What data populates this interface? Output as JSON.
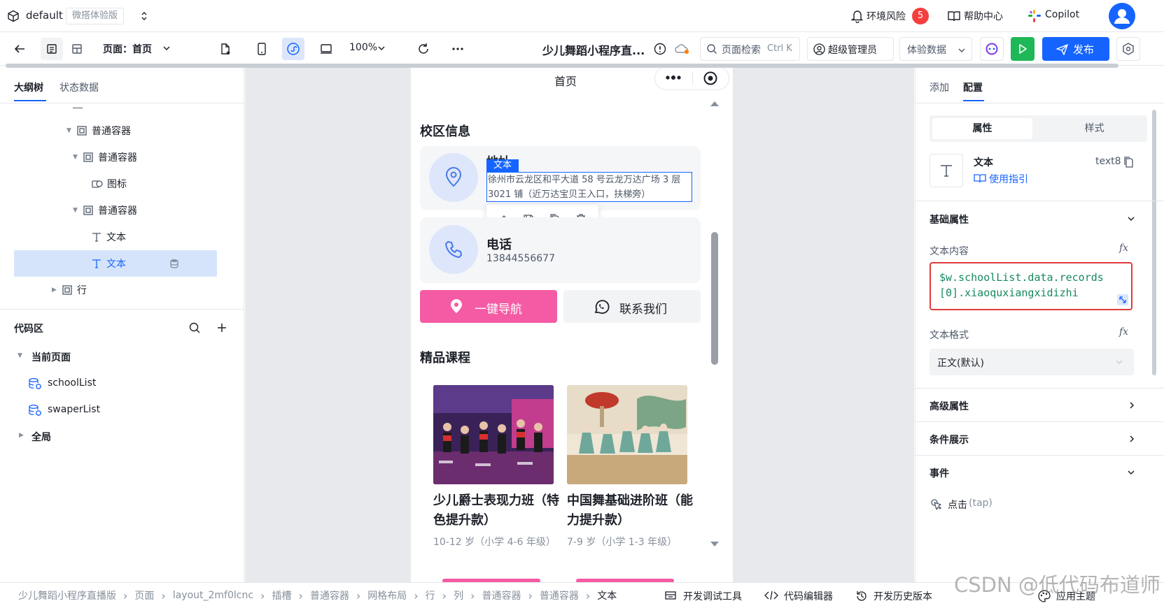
{
  "top_bar": {
    "app_name": "default",
    "env_badge": "微搭体验版",
    "risk_label": "环境风险",
    "risk_count": "5",
    "help_label": "帮助中心",
    "copilot_label": "Copilot"
  },
  "toolbar": {
    "page_selector": "页面：首页",
    "zoom": "100%",
    "app_title": "少儿舞蹈小程序直...",
    "search_label": "页面检索",
    "search_shortcut": "Ctrl K",
    "role_label": "超级管理员",
    "data_mode": "体验数据",
    "publish_label": "发布"
  },
  "left_panel": {
    "tabs": [
      "大纲树",
      "状态数据"
    ],
    "tree": [
      {
        "label": "普通容器",
        "icon": "container-icon"
      },
      {
        "label": "普通容器",
        "icon": "container-icon"
      },
      {
        "label": "图标",
        "icon": "icon-component-icon"
      },
      {
        "label": "普通容器",
        "icon": "container-icon"
      },
      {
        "label": "文本",
        "icon": "text-icon"
      },
      {
        "label": "文本",
        "icon": "text-icon"
      },
      {
        "label": "行",
        "icon": "container-icon"
      }
    ],
    "code_title": "代码区",
    "code_tree": {
      "current_page": "当前页面",
      "items": [
        "schoolList",
        "swaperList"
      ],
      "global": "全局"
    }
  },
  "phone": {
    "nav_title": "首页",
    "section1_title": "校区信息",
    "address_title": "地址",
    "selection_tag": "文本",
    "address_text": "徐州市云龙区和平大道 58 号云龙万达广场 3 层 3021 铺（近万达宝贝王入口，扶梯旁）",
    "phone_title": "电话",
    "phone_number": "13844556677",
    "nav_button": "一键导航",
    "contact_button": "联系我们",
    "section2_title": "精品课程",
    "courses": [
      {
        "title": "少儿爵士表现力班（特色提升款）",
        "meta": "10-12 岁（小学 4-6 年级）"
      },
      {
        "title": "中国舞基础进阶班（能力提升款）",
        "meta": "7-9 岁（小学 1-3 年级）"
      }
    ]
  },
  "right_panel": {
    "tabs": [
      "添加",
      "配置"
    ],
    "subtabs": [
      "属性",
      "样式"
    ],
    "component_name": "文本",
    "component_id": "text8",
    "guide_link": "使用指引",
    "basic_props": "基础属性",
    "text_content_label": "文本内容",
    "expression": "$w.schoolList.data.records[0].xiaoquxiangxidizhi",
    "text_format_label": "文本格式",
    "text_format_value": "正文(默认)",
    "advanced": "高级属性",
    "conditional": "条件展示",
    "events": "事件",
    "tap_event": "点击",
    "tap_event_code": "(tap)"
  },
  "status_bar": {
    "breadcrumb": [
      "少儿舞蹈小程序直播版",
      "页面",
      "layout_2mf0lcnc",
      "插槽",
      "普通容器",
      "网格布局",
      "行",
      "列",
      "普通容器",
      "普通容器",
      "文本"
    ],
    "debug_tools": "开发调试工具",
    "code_editor": "代码编辑器",
    "history": "开发历史版本",
    "theme": "应用主题"
  },
  "watermark": "CSDN @低代码布道师",
  "colors": {
    "primary": "#1664ff",
    "pink": "#f55ba4",
    "green": "#1fb858",
    "danger": "#f53f3f"
  }
}
